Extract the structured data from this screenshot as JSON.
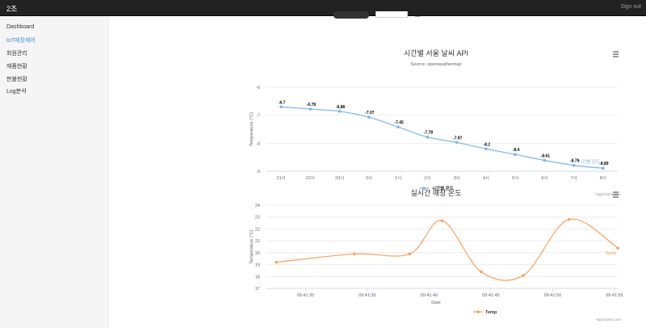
{
  "navbar": {
    "brand": "2조",
    "signout": "Sign out"
  },
  "sidebar": {
    "items": [
      {
        "label": "Dashboard",
        "active": false
      },
      {
        "label": "IoT매장제어",
        "active": true
      },
      {
        "label": "회원관리",
        "active": false
      },
      {
        "label": "재품현황",
        "active": false
      },
      {
        "label": "판불현황",
        "active": false
      },
      {
        "label": "Log분석",
        "active": false
      }
    ]
  },
  "chart_data": [
    {
      "type": "line",
      "title": "시간별 서울 날씨 API",
      "subtitle": "Source: openweathermap",
      "ylabel": "Temperature (°C)",
      "xlabel": "",
      "categories": [
        "21시",
        "22시",
        "23시",
        "0시",
        "1시",
        "2시",
        "3시",
        "4시",
        "5시",
        "6시",
        "7시",
        "8시"
      ],
      "series": [
        {
          "name": "시간별 온도",
          "values": [
            -6.7,
            -6.78,
            -6.86,
            -7.07,
            -7.42,
            -7.78,
            -7.97,
            -8.2,
            -8.4,
            -8.61,
            -8.79,
            -8.89
          ],
          "color": "#7cb5ec"
        }
      ],
      "data_labels": [
        "-6.7",
        "-6.78",
        "-6.86",
        "-7.07",
        "-7.42",
        "-7.78",
        "-7.97",
        "-8.2",
        "-8.4",
        "-8.61",
        "-8.79",
        "-8.89"
      ],
      "end_label": "시간별 온도",
      "ylim": [
        -9,
        -6
      ],
      "yticks": [
        "-6",
        "-7",
        "-8",
        "-9"
      ],
      "legend": "bottom",
      "credits": "Highcharts.com"
    },
    {
      "type": "line",
      "title": "실시간 매장 온도",
      "subtitle": "",
      "ylabel": "Temperature (°C)",
      "xlabel": "Date",
      "xticks": [
        "09:41:30",
        "09:41:35",
        "09:41:40",
        "09:41:45",
        "09:41:50",
        "09:41:55"
      ],
      "x": [
        0,
        2.4,
        4.1,
        5.1,
        6.3,
        7.6,
        9.0,
        10.5
      ],
      "series": [
        {
          "name": "Temp",
          "values": [
            19.2,
            19.9,
            19.9,
            22.7,
            18.4,
            18.1,
            22.8,
            20.4
          ],
          "color": "#f7a35c"
        }
      ],
      "end_label": "Temp",
      "ylim": [
        17,
        24
      ],
      "yticks": [
        "24",
        "23",
        "22",
        "21",
        "20",
        "19",
        "18",
        "17"
      ],
      "legend": "bottom",
      "credits": "Highcharts.com"
    }
  ]
}
